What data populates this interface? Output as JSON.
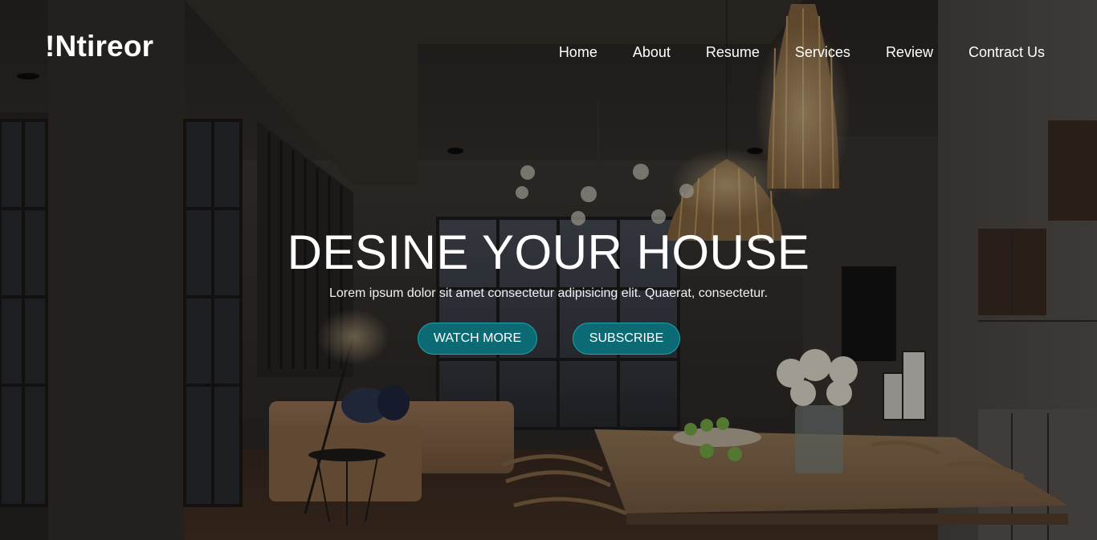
{
  "brand": {
    "logo": "!Ntireor"
  },
  "nav": {
    "items": [
      {
        "label": "Home"
      },
      {
        "label": "About"
      },
      {
        "label": "Resume"
      },
      {
        "label": "Services"
      },
      {
        "label": "Review"
      },
      {
        "label": "Contract Us"
      }
    ]
  },
  "hero": {
    "headline": "DESINE YOUR HOUSE",
    "subtext": "Lorem ipsum dolor sit amet consectetur adipisicing elit. Quaerat, consectetur.",
    "buttons": {
      "watch_more": "WATCH MORE",
      "subscribe": "SUBSCRIBE"
    },
    "background": "interior-room-photo"
  },
  "colors": {
    "button_fill": "#0b6a73",
    "button_border": "#21a5ad",
    "text": "#ffffff",
    "overlay": "#1e1b19"
  }
}
